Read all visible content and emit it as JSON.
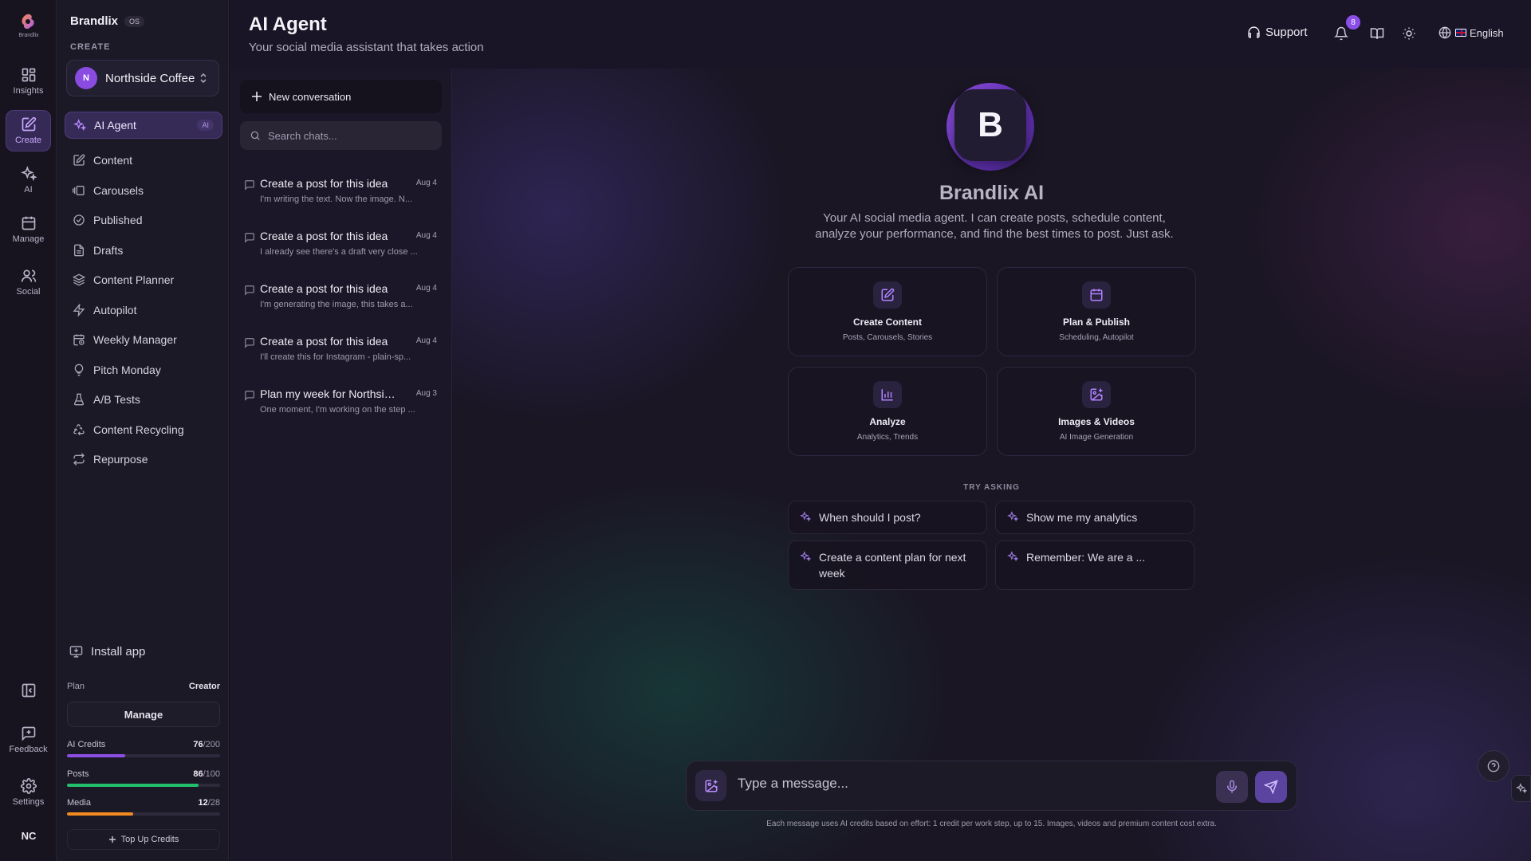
{
  "rail": {
    "logo_text": "Brandlix",
    "items": [
      {
        "label": "Insights",
        "icon": "grid-icon"
      },
      {
        "label": "Create",
        "icon": "edit-icon"
      },
      {
        "label": "AI",
        "icon": "sparkles-icon"
      },
      {
        "label": "Manage",
        "icon": "calendar-icon"
      },
      {
        "label": "Social",
        "icon": "users-icon"
      }
    ],
    "bottom": [
      {
        "label": "",
        "icon": "sidebar-collapse-icon"
      },
      {
        "label": "Feedback",
        "icon": "message-plus-icon"
      },
      {
        "label": "Settings",
        "icon": "gear-icon"
      }
    ],
    "avatar": "NC"
  },
  "sidebar": {
    "brand": "Brandlix",
    "brand_badge": "OS",
    "section_label": "CREATE",
    "account": {
      "initial": "N",
      "name": "Northside Coffee"
    },
    "items": [
      {
        "label": "AI Agent",
        "badge": "AI",
        "icon": "sparkles-icon"
      },
      {
        "label": "Content",
        "icon": "edit-icon"
      },
      {
        "label": "Carousels",
        "icon": "carousel-icon"
      },
      {
        "label": "Published",
        "icon": "check-circle-icon"
      },
      {
        "label": "Drafts",
        "icon": "file-icon"
      },
      {
        "label": "Content Planner",
        "icon": "layers-icon"
      },
      {
        "label": "Autopilot",
        "icon": "zap-icon"
      },
      {
        "label": "Weekly Manager",
        "icon": "calendar-clock-icon"
      },
      {
        "label": "Pitch Monday",
        "icon": "lightbulb-icon"
      },
      {
        "label": "A/B Tests",
        "icon": "flask-icon"
      },
      {
        "label": "Content Recycling",
        "icon": "recycle-icon"
      },
      {
        "label": "Repurpose",
        "icon": "repeat-icon"
      }
    ],
    "install_label": "Install app",
    "plan_label": "Plan",
    "plan_value": "Creator",
    "manage_label": "Manage",
    "usage": [
      {
        "label": "AI Credits",
        "used": "76",
        "total": "/200",
        "fraction": 0.38,
        "color": "#8c4fe3"
      },
      {
        "label": "Posts",
        "used": "86",
        "total": "/100",
        "fraction": 0.86,
        "color": "#22c06a"
      },
      {
        "label": "Media",
        "used": "12",
        "total": "/28",
        "fraction": 0.43,
        "color": "#f38a1f"
      }
    ],
    "topup_label": "Top Up Credits"
  },
  "header": {
    "title": "AI Agent",
    "subtitle": "Your social media assistant that takes action",
    "support_label": "Support",
    "notification_count": "8",
    "language": "English"
  },
  "chat_list": {
    "new_label": "New conversation",
    "search_placeholder": "Search chats...",
    "items": [
      {
        "title": "Create a post for this idea",
        "date": "Aug 4",
        "preview": "I'm writing the text. Now the image. N..."
      },
      {
        "title": "Create a post for this idea",
        "date": "Aug 4",
        "preview": "I already see there's a draft very close ..."
      },
      {
        "title": "Create a post for this idea",
        "date": "Aug 4",
        "preview": "I'm generating the image, this takes a..."
      },
      {
        "title": "Create a post for this idea",
        "date": "Aug 4",
        "preview": "I'll create this for Instagram - plain-sp..."
      },
      {
        "title": "Plan my week for Northside Coffee",
        "date": "Aug 3",
        "preview": "One moment, I'm working on the step ..."
      }
    ]
  },
  "main": {
    "logo_letter": "B",
    "title": "Brandlix AI",
    "description": "Your AI social media agent. I can create posts, schedule content, analyze your performance, and find the best times to post. Just ask.",
    "capabilities": [
      {
        "title": "Create Content",
        "subtitle": "Posts, Carousels, Stories",
        "icon": "edit-icon"
      },
      {
        "title": "Plan & Publish",
        "subtitle": "Scheduling, Autopilot",
        "icon": "calendar-icon"
      },
      {
        "title": "Analyze",
        "subtitle": "Analytics, Trends",
        "icon": "bar-chart-icon"
      },
      {
        "title": "Images & Videos",
        "subtitle": "AI Image Generation",
        "icon": "image-plus-icon"
      }
    ],
    "try_label": "TRY ASKING",
    "suggestions": [
      "When should I post?",
      "Show me my analytics",
      "Create a content plan for next week",
      "Remember: We are a ..."
    ],
    "composer_placeholder": "Type a message...",
    "disclaimer": "Each message uses AI credits based on effort: 1 credit per work step, up to 15. Images, videos and premium content cost extra."
  }
}
